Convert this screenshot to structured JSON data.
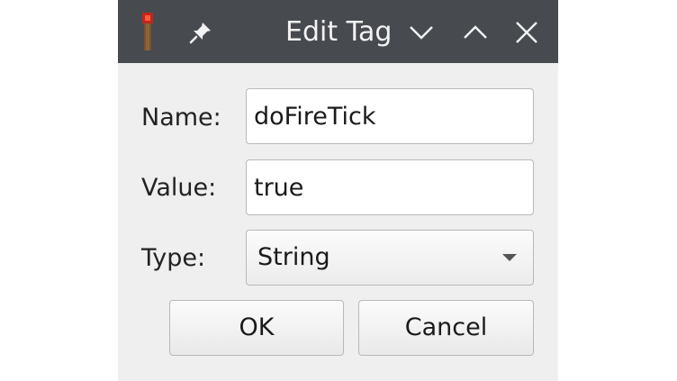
{
  "window": {
    "title": "Edit Tag",
    "icons": {
      "app": "redstone-torch-icon",
      "pin": "pin-icon",
      "minimize": "chevron-down-icon",
      "maximize": "chevron-up-icon",
      "close": "close-icon"
    },
    "colors": {
      "titlebar": "#474a4f",
      "body": "#efefef"
    }
  },
  "form": {
    "name_label": "Name:",
    "name_value": "doFireTick",
    "value_label": "Value:",
    "value_value": "true",
    "type_label": "Type:",
    "type_selected": "String"
  },
  "buttons": {
    "ok": "OK",
    "cancel": "Cancel"
  }
}
